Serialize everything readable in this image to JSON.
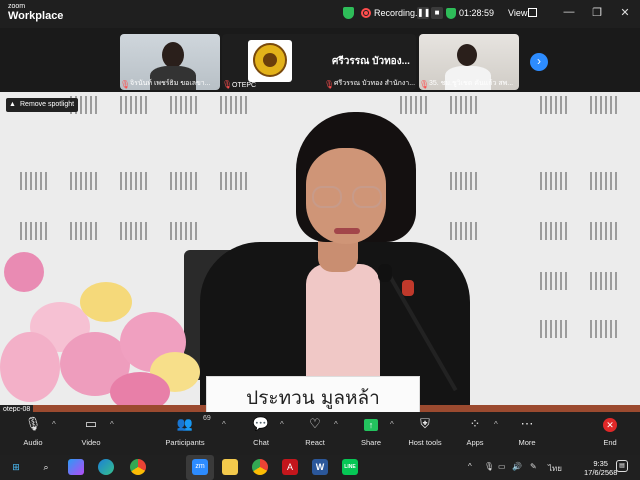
{
  "titlebar": {
    "brand_small": "zoom",
    "brand_big": "Workplace",
    "recording_label": "Recording...",
    "pause_icon": "pause-icon",
    "stop_icon": "stop-icon",
    "timer": "01:28:59",
    "view_label": "View",
    "window_controls": [
      "minimize-icon",
      "restore-icon",
      "close-icon"
    ]
  },
  "gallery": {
    "tiles": [
      {
        "name": "จิรนันท์ เพชร์ธิม ขอเลขา..."
      },
      {
        "name": "OTEPC",
        "title": "ศรีวรรณ บัวทอง..."
      },
      {
        "name": "ศรีวรรณ บัวทอง สำนักงา...",
        "hidden_under": true
      },
      {
        "name": "35. ชม.ชูวิเชต คันแก้ว สพ..."
      }
    ],
    "next_icon": "chevron-right-icon"
  },
  "video": {
    "spotlight_label": "Remove spotlight",
    "nameplate": "ประทวน มูลหล้า",
    "participant_label": "otepc-08"
  },
  "toolbar": {
    "items": [
      {
        "icon": "mic-icon",
        "label": "Audio"
      },
      {
        "icon": "video-camera-icon",
        "label": "Video"
      },
      {
        "icon": "participants-icon",
        "label": "Participants",
        "count": "69"
      },
      {
        "icon": "chat-icon",
        "label": "Chat"
      },
      {
        "icon": "heart-icon",
        "label": "React"
      },
      {
        "icon": "share-icon",
        "label": "Share"
      },
      {
        "icon": "shield-icon",
        "label": "Host tools"
      },
      {
        "icon": "apps-icon",
        "label": "Apps"
      },
      {
        "icon": "more-icon",
        "label": "More"
      },
      {
        "icon": "end-icon",
        "label": "End"
      }
    ]
  },
  "taskbar": {
    "icons": [
      "windows-start-icon",
      "search-icon",
      "widgets-icon",
      "edge-icon",
      "chrome-icon",
      "zoom-icon",
      "file-explorer-icon",
      "chrome-alt-icon",
      "acrobat-icon",
      "word-icon",
      "line-icon"
    ],
    "zoom_label": "zm",
    "word_label": "W",
    "line_label": "LINE",
    "language": "ไทย",
    "time": "9:35",
    "date": "17/6/2568"
  }
}
